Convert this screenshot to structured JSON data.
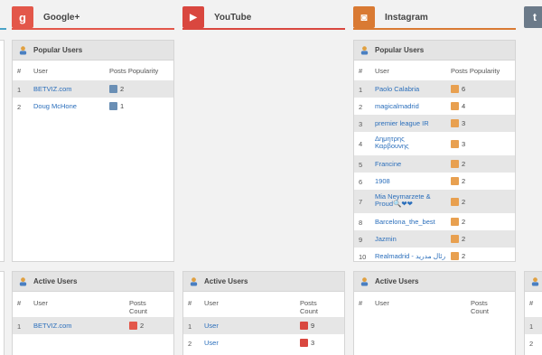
{
  "colors": {
    "google": "#e3574a",
    "youtube": "#d9473f",
    "instagram": "#d97a33",
    "tumblr": "#6b7a89",
    "link": "#2a6ebb"
  },
  "columns": {
    "google": {
      "title": "Google+",
      "icon": "google-plus-icon",
      "icon_glyph": "g",
      "popular": {
        "title": "Popular Users",
        "headers": {
          "num": "#",
          "user": "User",
          "value": "Posts Popularity"
        },
        "rows": [
          {
            "num": "1",
            "user": "BETVIZ.com",
            "value": "2"
          },
          {
            "num": "2",
            "user": "Doug McHone",
            "value": "1"
          }
        ]
      },
      "active": {
        "title": "Active Users",
        "headers": {
          "num": "#",
          "user": "User",
          "value": "Posts Count"
        },
        "rows": [
          {
            "num": "1",
            "user": "BETVIZ.com",
            "value": "2"
          }
        ]
      }
    },
    "youtube": {
      "title": "YouTube",
      "icon": "youtube-icon",
      "icon_glyph": "▶",
      "active": {
        "title": "Active Users",
        "headers": {
          "num": "#",
          "user": "User",
          "value": "Posts Count"
        },
        "rows": [
          {
            "num": "1",
            "user": "User",
            "value": "9"
          },
          {
            "num": "2",
            "user": "User",
            "value": "3"
          }
        ]
      }
    },
    "instagram": {
      "title": "Instagram",
      "icon": "instagram-icon",
      "icon_glyph": "◙",
      "popular": {
        "title": "Popular Users",
        "headers": {
          "num": "#",
          "user": "User",
          "value": "Posts Popularity"
        },
        "rows": [
          {
            "num": "1",
            "user": "Paolo Calabria",
            "value": "6"
          },
          {
            "num": "2",
            "user": "magicalmadrid",
            "value": "4"
          },
          {
            "num": "3",
            "user": "premier league IR",
            "value": "3"
          },
          {
            "num": "4",
            "user": "Δημητρης Καρβουνης",
            "value": "3"
          },
          {
            "num": "5",
            "user": "Francine",
            "value": "2"
          },
          {
            "num": "6",
            "user": "1908",
            "value": "2"
          },
          {
            "num": "7",
            "user": "Mia Neymarzete & Proud🔍❤❤",
            "value": "2"
          },
          {
            "num": "8",
            "user": "Barcelona_the_best",
            "value": "2"
          },
          {
            "num": "9",
            "user": "Jazmin",
            "value": "2"
          },
          {
            "num": "10",
            "user": "Realmadrid - رئال مدرید",
            "value": "2"
          }
        ]
      },
      "active": {
        "title": "Active Users",
        "headers": {
          "num": "#",
          "user": "User",
          "value": "Posts Count"
        }
      }
    },
    "tumblr": {
      "icon": "tumblr-icon",
      "icon_glyph": "t",
      "active_rows": [
        {
          "num": "1"
        },
        {
          "num": "2"
        }
      ]
    }
  }
}
